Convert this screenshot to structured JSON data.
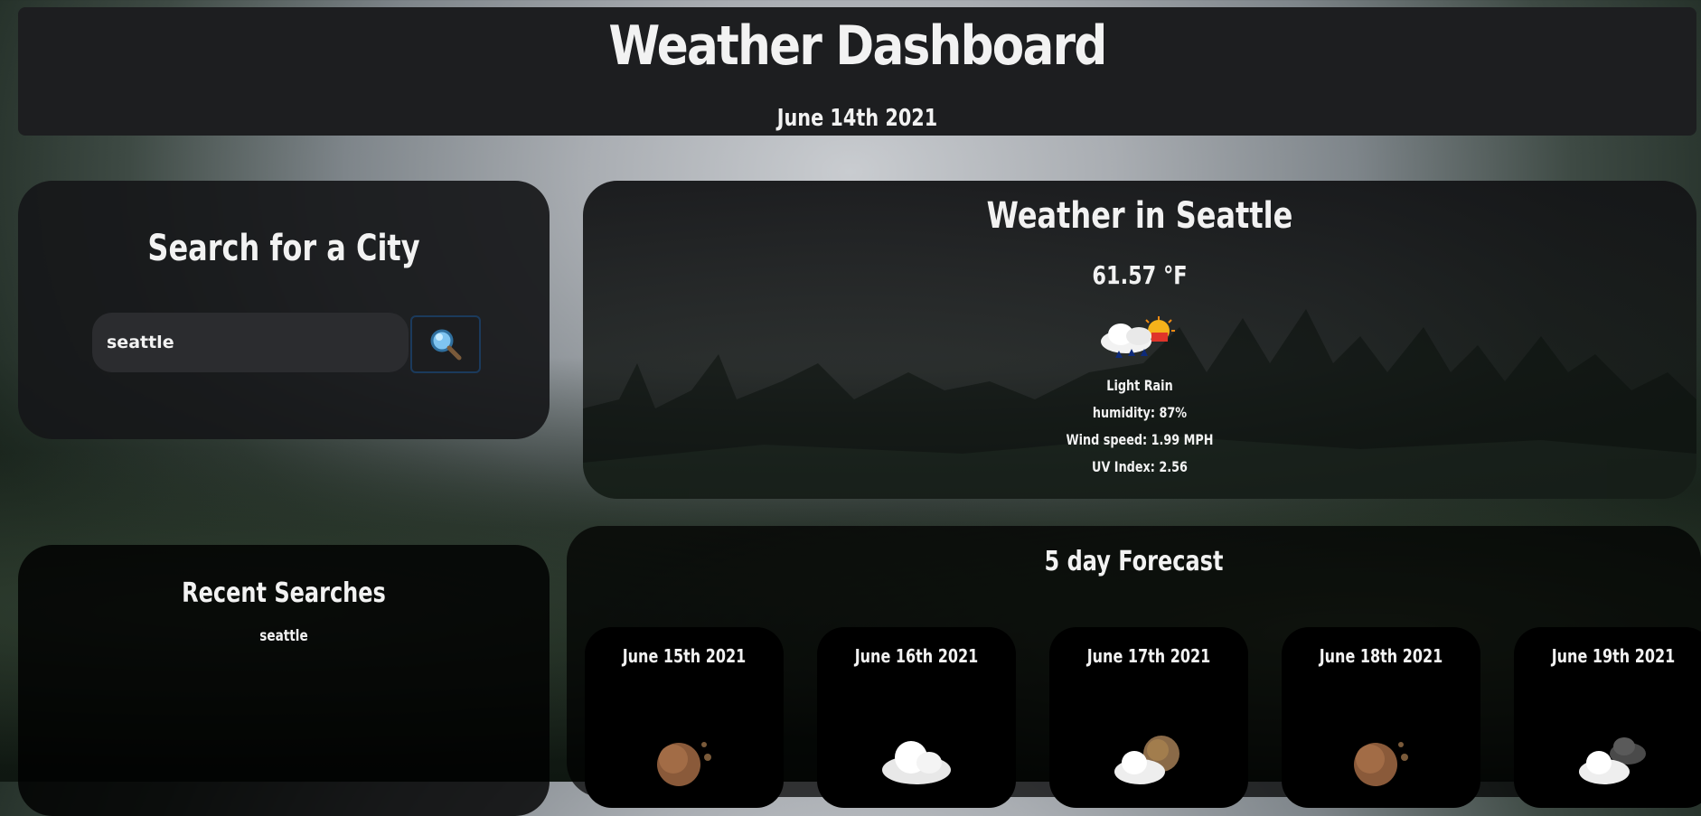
{
  "header": {
    "title": "Weather Dashboard",
    "date": "June 14th 2021"
  },
  "search": {
    "title": "Search for a City",
    "input_value": "seattle",
    "button_icon": "search-icon"
  },
  "recent": {
    "title": "Recent Searches",
    "items": [
      "seattle"
    ]
  },
  "current": {
    "title": "Weather in Seattle",
    "temperature": "61.57 °F",
    "icon": "light-rain-icon",
    "description": "Light Rain",
    "humidity": "humidity: 87%",
    "wind": "Wind speed: 1.99 MPH",
    "uv": "UV Index: 2.56"
  },
  "forecast": {
    "title": "5 day Forecast",
    "days": [
      {
        "date": "June 15th 2021",
        "icon": "moon-icon"
      },
      {
        "date": "June 16th 2021",
        "icon": "cloud-icon"
      },
      {
        "date": "June 17th 2021",
        "icon": "cloud-moon-icon"
      },
      {
        "date": "June 18th 2021",
        "icon": "moon-icon"
      },
      {
        "date": "June 19th 2021",
        "icon": "cloud-storm-icon"
      }
    ]
  },
  "colors": {
    "panel": "#1d1e20",
    "text": "#f2f2f2",
    "button_border": "#1b3a5c"
  }
}
